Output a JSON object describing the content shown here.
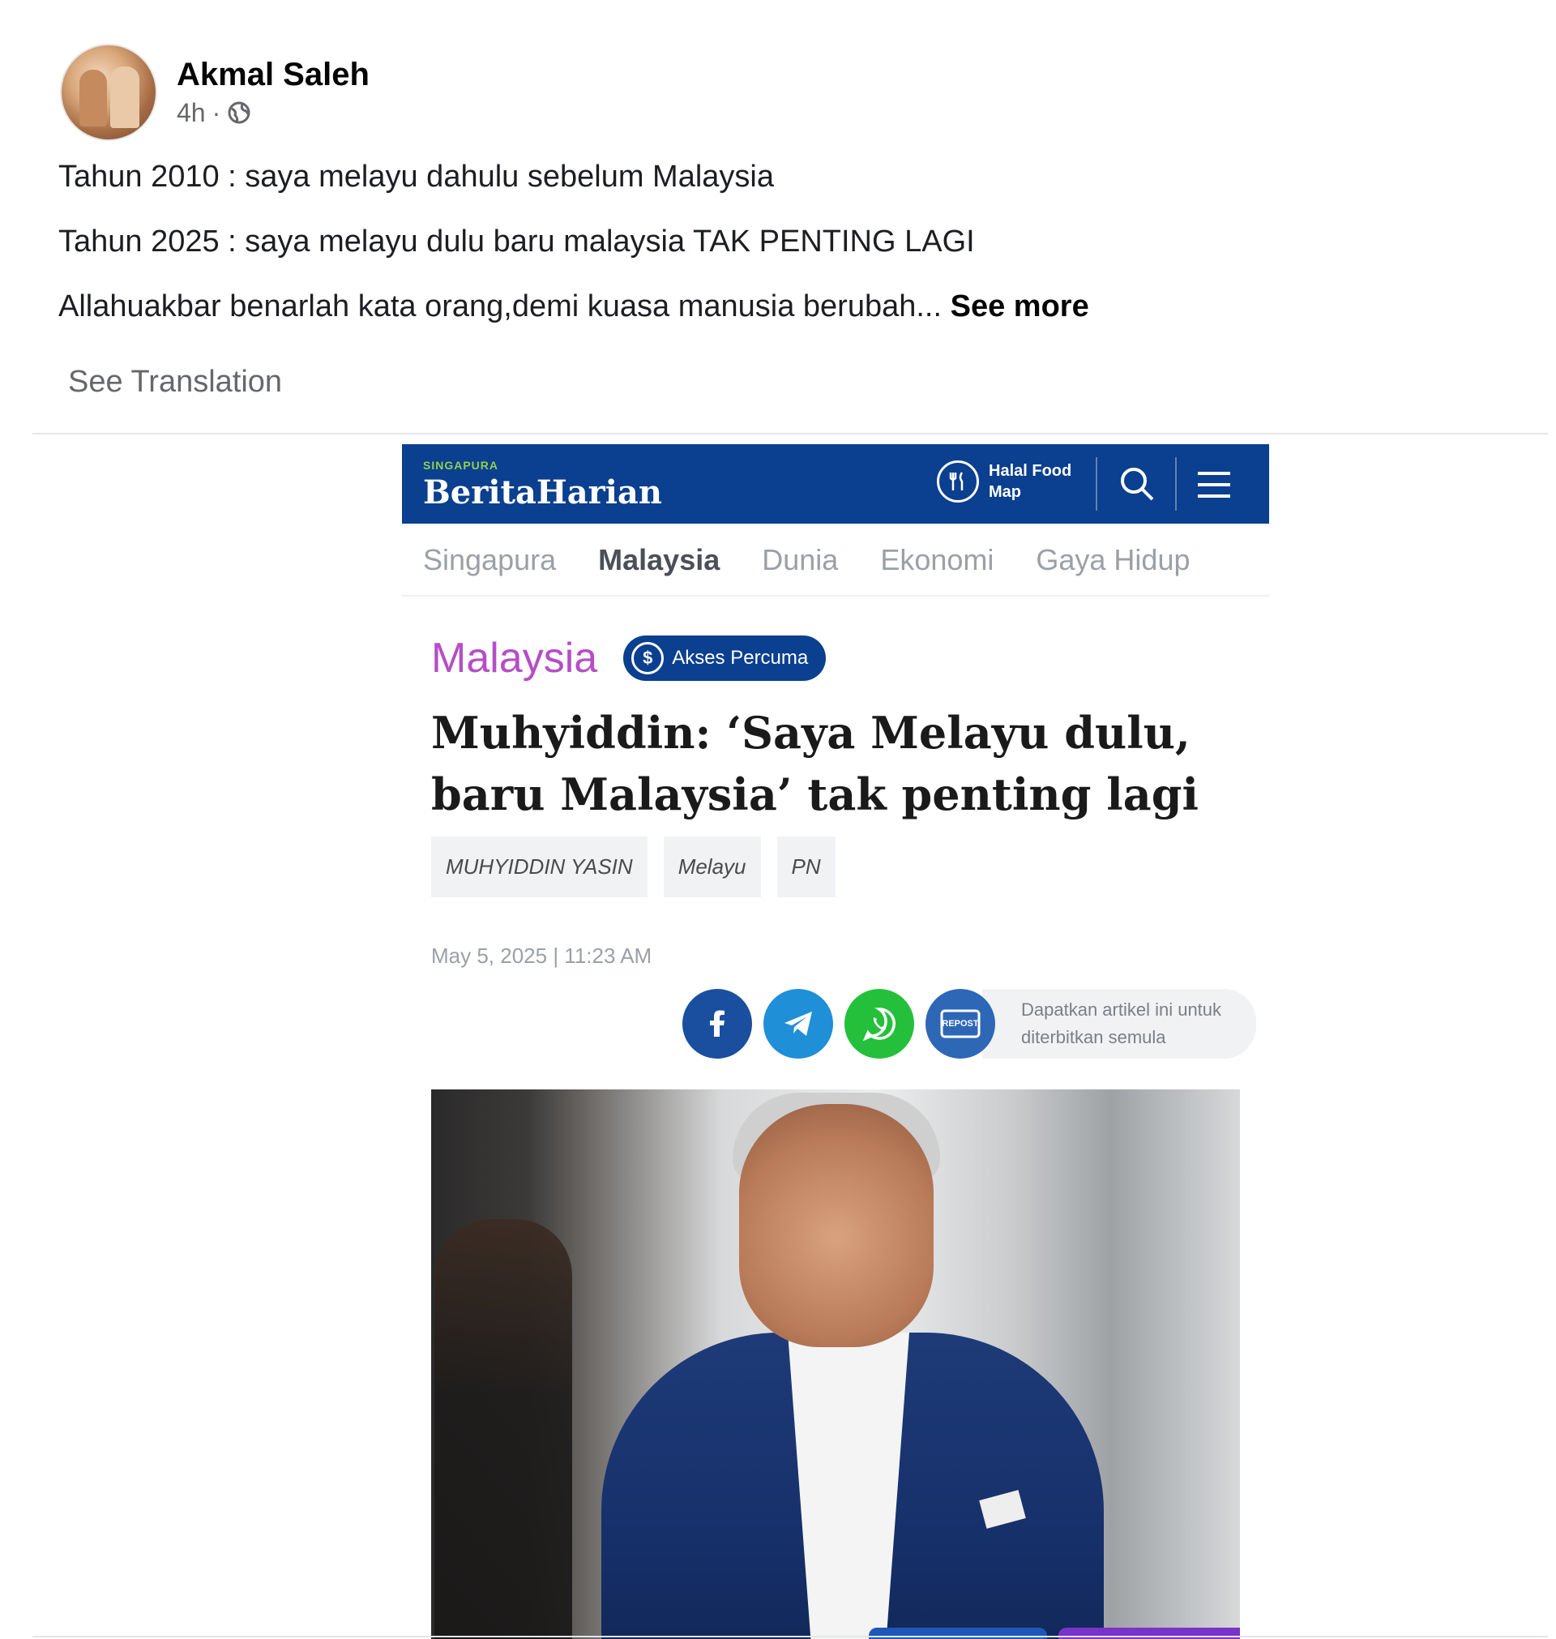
{
  "post": {
    "author": "Akmal Saleh",
    "time": "4h",
    "separator": "·",
    "lines": [
      "Tahun 2010 : saya melayu dahulu sebelum Malaysia",
      "Tahun 2025 : saya melayu dulu baru malaysia TAK PENTING LAGI",
      "Allahuakbar benarlah kata orang,demi kuasa manusia berubah..."
    ],
    "see_more": "See more",
    "see_translation": "See Translation"
  },
  "article": {
    "brand_small": "SINGAPURA",
    "brand": "BeritaHarian",
    "halal_label": "Halal Food Map",
    "nav": [
      "Singapura",
      "Malaysia",
      "Dunia",
      "Ekonomi",
      "Gaya Hidup"
    ],
    "nav_active": "Malaysia",
    "section": "Malaysia",
    "badge": "Akses Percuma",
    "headline": "Muhyiddin: ‘Saya Melayu dulu, baru Malaysia’ tak penting lagi",
    "tags": [
      "MUHYIDDIN YASIN",
      "Melayu",
      "PN"
    ],
    "date": "May 5, 2025 | 11:23 AM",
    "republish_icon_text": "REPOST",
    "republish": "Dapatkan artikel ini untuk diterbitkan semula",
    "colors": {
      "brand_blue": "#0b3f8f",
      "section_purple": "#b54ec6",
      "facebook": "#1a4fa0",
      "telegram": "#1f8fd8",
      "whatsapp": "#25c03b"
    }
  },
  "icons": {
    "privacy": "globe-icon",
    "halal": "fork-spoon-icon",
    "search": "search-icon",
    "menu": "hamburger-menu-icon",
    "badge": "dollar-icon",
    "share": [
      "facebook-icon",
      "telegram-icon",
      "whatsapp-icon",
      "republish-icon"
    ]
  }
}
